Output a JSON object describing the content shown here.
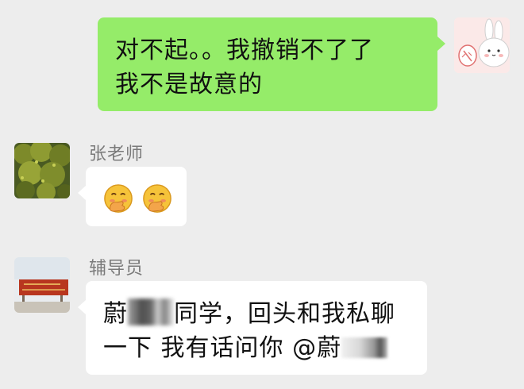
{
  "messages": [
    {
      "side": "right",
      "sender": "",
      "line1": "对不起。。我撤销不了了",
      "line2": "我不是故意的"
    },
    {
      "side": "left",
      "sender": "张老师",
      "emoji": [
        "covering-mouth-laugh",
        "covering-mouth-laugh"
      ]
    },
    {
      "side": "left",
      "sender": "辅导员",
      "line1_prefix": "蔚",
      "line1_suffix": "同学，回头和我私聊",
      "line2_prefix": "一下 我有话问你 @蔚"
    }
  ],
  "colors": {
    "chat_background": "#ededed",
    "my_bubble": "#95ec69",
    "other_bubble": "#ffffff",
    "sender_name": "#7a7a7a"
  },
  "icons": {
    "my_avatar": "bunny-avatar",
    "teacher_avatar": "tree-photo-avatar",
    "counselor_avatar": "campus-banner-avatar",
    "reaction": "shy-laugh-emoji"
  }
}
